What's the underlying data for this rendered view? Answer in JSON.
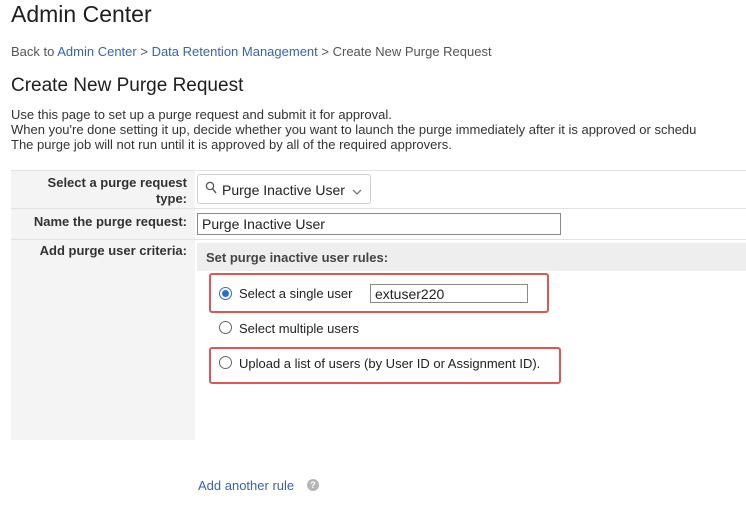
{
  "header": {
    "title": "Admin Center"
  },
  "breadcrumb": {
    "prefix": "Back to ",
    "items": [
      {
        "label": "Admin Center"
      },
      {
        "label": "Data Retention Management"
      }
    ],
    "separator": " > ",
    "current": "Create New Purge Request"
  },
  "page": {
    "title": "Create New Purge Request",
    "description": [
      "Use this page to set up a purge request and submit it for approval.",
      "When you're done setting it up, decide whether you want to launch the purge immediately after it is approved or schedu",
      "The purge job will not run until it is approved by all of the required approvers."
    ]
  },
  "form": {
    "request_type": {
      "label_line1": "Select a purge request",
      "label_line2": "type:",
      "value": "Purge Inactive User",
      "icon": "search-icon"
    },
    "request_name": {
      "label": "Name the purge request:",
      "value": "Purge Inactive User"
    },
    "criteria": {
      "label": "Add purge user criteria:",
      "panel_title": "Set purge inactive user rules:",
      "options": [
        {
          "label": "Select a single user",
          "checked": true,
          "input_value": "extuser220"
        },
        {
          "label": "Select multiple users",
          "checked": false
        },
        {
          "label": "Upload a list of users (by User ID or Assignment ID).",
          "checked": false
        }
      ],
      "add_rule": "Add another rule",
      "help_icon": "question-circle-icon"
    }
  },
  "colors": {
    "link": "#3a5fbf",
    "highlight": "#e05555",
    "radio_selected": "#2b6fd6"
  }
}
